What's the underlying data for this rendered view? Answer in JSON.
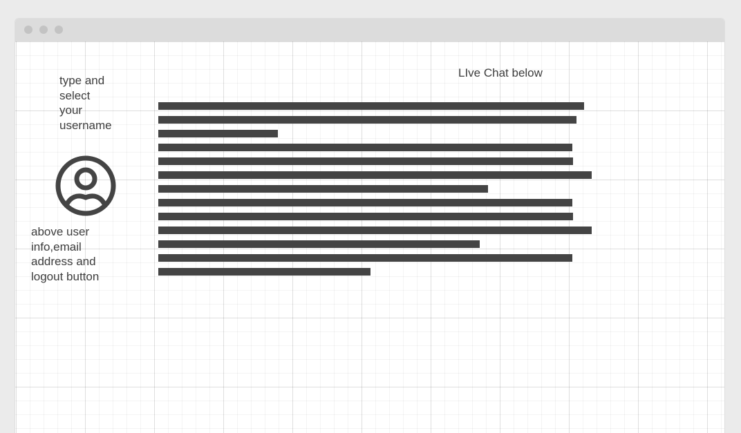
{
  "window": {
    "controls": [
      "close-dot",
      "minimize-dot",
      "maximize-dot"
    ]
  },
  "sidebar": {
    "username_note": "type and\nselect\nyour\nusername",
    "avatar_icon": "user-circle-icon",
    "user_info_note": "above user\ninfo,email\naddress and\nlogout button"
  },
  "chat": {
    "heading": "LIve Chat below",
    "placeholder_lines": [
      {
        "length": 0.983
      },
      {
        "length": 0.965
      },
      {
        "length": 0.276
      },
      {
        "length": 0.955
      },
      {
        "length": 0.957
      },
      {
        "length": 1.0
      },
      {
        "length": 0.76
      },
      {
        "length": 0.955
      },
      {
        "length": 0.957
      },
      {
        "length": 1.0
      },
      {
        "length": 0.742
      },
      {
        "length": 0.955
      },
      {
        "length": 0.49
      }
    ]
  },
  "colors": {
    "ink": "#444444",
    "text": "#3d3d3d",
    "titlebar": "#dcdcdc",
    "window_dot": "#c3c3c3"
  }
}
